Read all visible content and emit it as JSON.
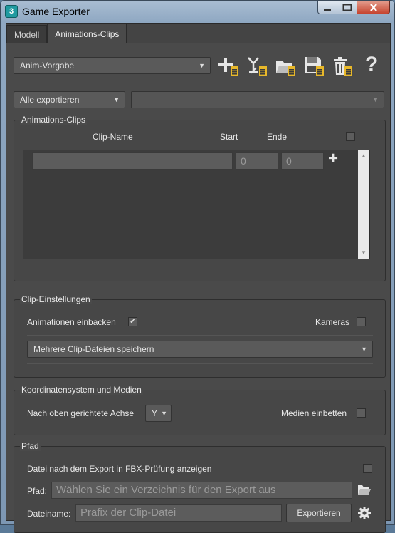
{
  "window": {
    "title": "Game Exporter",
    "app_icon_text": "3"
  },
  "tabs": [
    {
      "label": "Modell",
      "active": false
    },
    {
      "label": "Animations-Clips",
      "active": true
    }
  ],
  "preset": {
    "value": "Anim-Vorgabe"
  },
  "toolbar": {
    "icons": [
      "add-preset-icon",
      "edit-preset-icon",
      "open-folder-preset-icon",
      "save-preset-icon",
      "delete-preset-icon",
      "help-icon"
    ],
    "help_label": "?"
  },
  "export_mode": {
    "value": "Alle exportieren"
  },
  "secondary_dropdown": {
    "value": ""
  },
  "clips_group": {
    "legend": "Animations-Clips",
    "col_clip_name": "Clip-Name",
    "col_start": "Start",
    "col_end": "Ende",
    "row": {
      "clip_name": "",
      "start": "0",
      "end": "0"
    },
    "add_label": "+"
  },
  "clip_settings": {
    "legend": "Clip-Einstellungen",
    "bake_label": "Animationen einbacken",
    "bake_checked": true,
    "cameras_label": "Kameras",
    "cameras_checked": false,
    "save_mode": "Mehrere Clip-Dateien speichern"
  },
  "coords": {
    "legend": "Koordinatensystem und Medien",
    "up_axis_label": "Nach oben gerichtete Achse",
    "up_axis_value": "Y",
    "embed_media_label": "Medien einbetten",
    "embed_media_checked": false
  },
  "path_group": {
    "legend": "Pfad",
    "fbx_review_label": "Datei nach dem Export in FBX-Prüfung anzeigen",
    "fbx_review_checked": false,
    "path_label": "Pfad:",
    "path_placeholder": "Wählen Sie ein Verzeichnis für den Export aus",
    "filename_label": "Dateiname:",
    "filename_placeholder": "Präfix der Clip-Datei",
    "export_button": "Exportieren"
  },
  "colors": {
    "accent_yellow": "#e8b82a",
    "panel_bg": "#4a4a4a"
  }
}
